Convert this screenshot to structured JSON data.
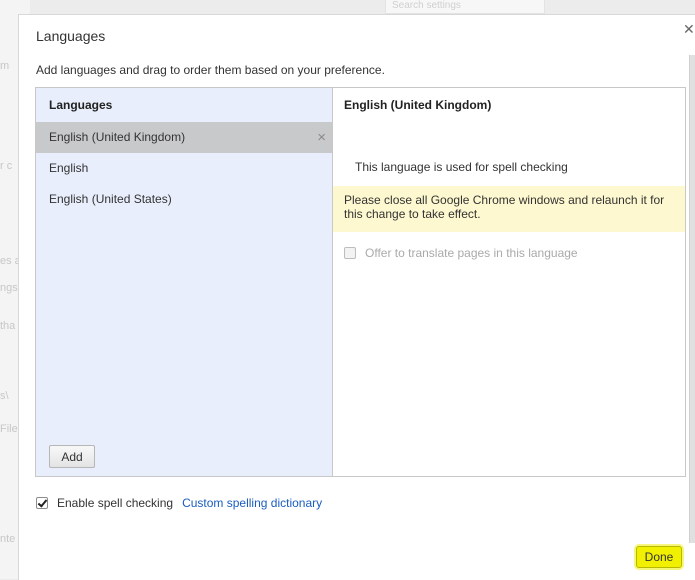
{
  "background": {
    "search_box": "Search settings",
    "fragments": [
      "m",
      "r c",
      "es a",
      "ngs",
      "tha",
      "s\\",
      "File",
      "nte"
    ]
  },
  "dialog": {
    "title": "Languages",
    "close_icon": "close-icon",
    "intro": "Add languages and drag to order them based on your preference.",
    "list_header": "Languages",
    "languages": [
      {
        "label": "English (United Kingdom)",
        "selected": true
      },
      {
        "label": "English",
        "selected": false
      },
      {
        "label": "English (United States)",
        "selected": false
      }
    ],
    "remove_icon": "×",
    "add_button": "Add",
    "detail": {
      "title": "English (United Kingdom)",
      "spell_note": "This language is used for spell checking",
      "relaunch_message": "Please close all Google Chrome windows and relaunch it for this change to take effect.",
      "translate_label": "Offer to translate pages in this language",
      "translate_checked": false
    },
    "spellcheck_label": "Enable spell checking",
    "spellcheck_checked": true,
    "custom_dictionary_link": "Custom spelling dictionary",
    "done_button": "Done",
    "colors": {
      "highlight": "#f0f000",
      "link": "#1a5dbf",
      "list_bg": "#e8eefb",
      "notice_bg": "#fdf8cf"
    }
  }
}
